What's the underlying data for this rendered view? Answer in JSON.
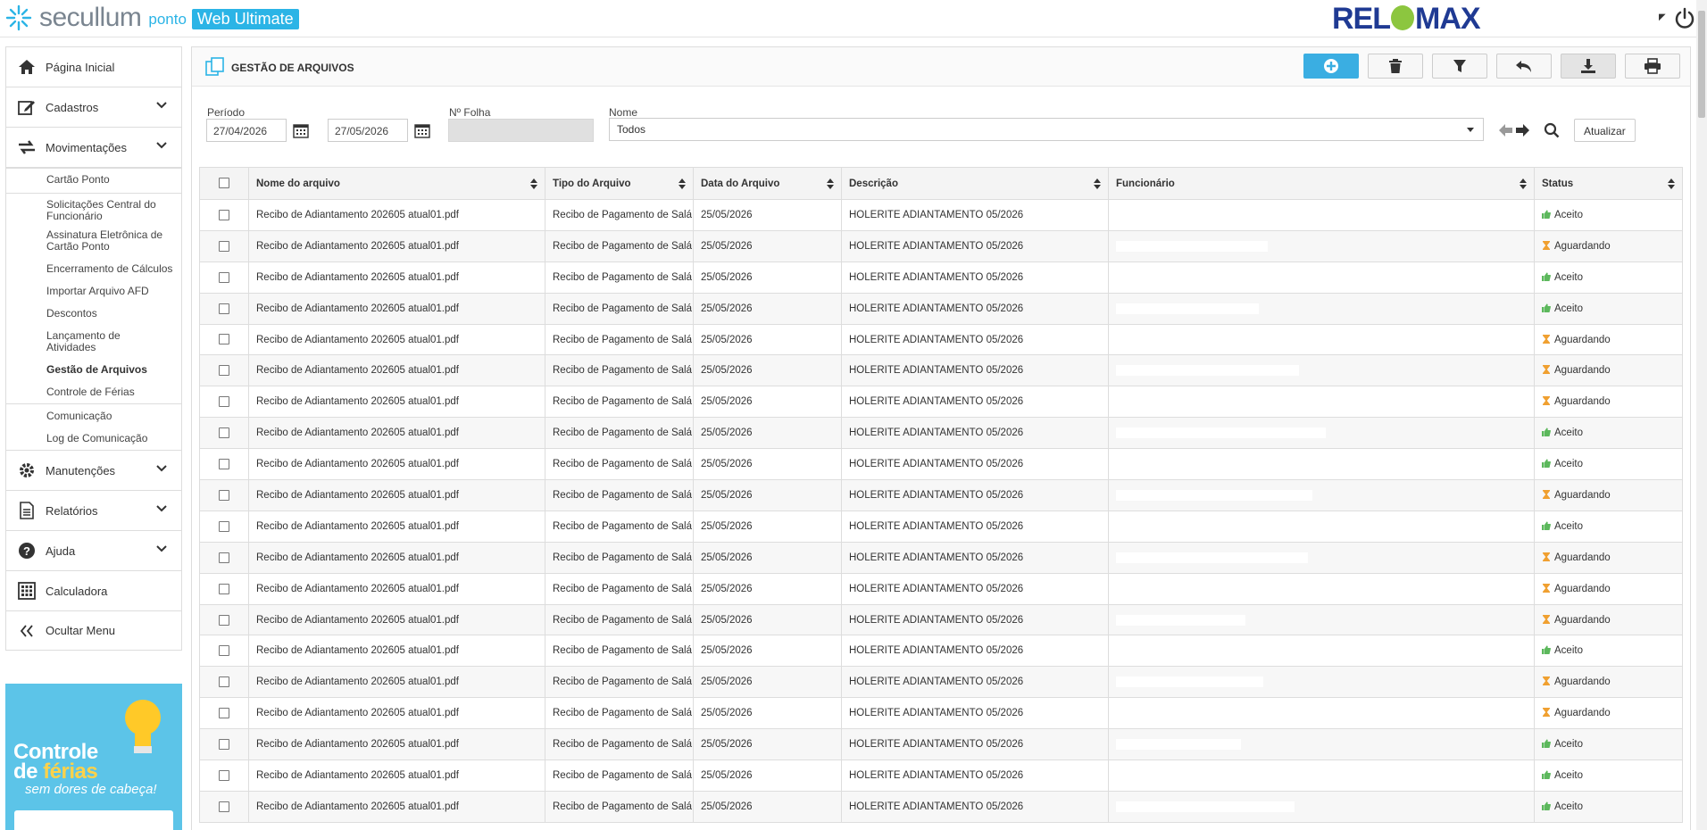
{
  "header": {
    "brand": "secullum",
    "brand_sub": "ponto",
    "brand_badge": "Web Ultimate",
    "client_logo_left": "REL",
    "client_logo_right": "MAX"
  },
  "sidebar": {
    "items": [
      {
        "label": "Página Inicial",
        "icon": "home-icon"
      },
      {
        "label": "Cadastros",
        "icon": "edit-icon"
      },
      {
        "label": "Movimentações",
        "icon": "exchange-icon"
      }
    ],
    "submenu": [
      "Cartão Ponto",
      "Solicitações Central do Funcionário",
      "Assinatura Eletrônica de Cartão Ponto",
      "Encerramento de Cálculos",
      "Importar Arquivo AFD",
      "Descontos",
      "Lançamento de Atividades",
      "Gestão de Arquivos",
      "Controle de Férias",
      "Comunicação",
      "Log de Comunicação"
    ],
    "items_after": [
      {
        "label": "Manutenções",
        "icon": "gear-icon"
      },
      {
        "label": "Relatórios",
        "icon": "document-icon"
      },
      {
        "label": "Ajuda",
        "icon": "help-icon"
      },
      {
        "label": "Calculadora",
        "icon": "calculator-icon"
      },
      {
        "label": "Ocultar Menu",
        "icon": "double-chevron-left-icon"
      }
    ],
    "banner": {
      "line1": "Controle",
      "line2a": "de ",
      "line2b": "férias",
      "line3": "sem dores de cabeça!"
    }
  },
  "panel": {
    "title": "GESTÃO DE ARQUIVOS"
  },
  "filters": {
    "periodo_label": "Período",
    "date_from": "27/04/2026",
    "date_to": "27/05/2026",
    "folha_label": "Nº Folha",
    "folha_value": "",
    "nome_label": "Nome",
    "nome_value": "Todos",
    "atualizar_label": "Atualizar"
  },
  "table": {
    "columns": [
      "Nome do arquivo",
      "Tipo do Arquivo",
      "Data do Arquivo",
      "Descrição",
      "Funcionário",
      "Status"
    ],
    "rows": [
      {
        "file": "Recibo de Adiantamento 202605 atual01.pdf",
        "type": "Recibo de Pagamento de Salá",
        "date": "25/05/2026",
        "desc": "HOLERITE ADIANTAMENTO 05/2026",
        "status": "Aceito"
      },
      {
        "file": "Recibo de Adiantamento 202605 atual01.pdf",
        "type": "Recibo de Pagamento de Salá",
        "date": "25/05/2026",
        "desc": "HOLERITE ADIANTAMENTO 05/2026",
        "status": "Aguardando"
      },
      {
        "file": "Recibo de Adiantamento 202605 atual01.pdf",
        "type": "Recibo de Pagamento de Salá",
        "date": "25/05/2026",
        "desc": "HOLERITE ADIANTAMENTO 05/2026",
        "status": "Aceito"
      },
      {
        "file": "Recibo de Adiantamento 202605 atual01.pdf",
        "type": "Recibo de Pagamento de Salá",
        "date": "25/05/2026",
        "desc": "HOLERITE ADIANTAMENTO 05/2026",
        "status": "Aceito"
      },
      {
        "file": "Recibo de Adiantamento 202605 atual01.pdf",
        "type": "Recibo de Pagamento de Salá",
        "date": "25/05/2026",
        "desc": "HOLERITE ADIANTAMENTO 05/2026",
        "status": "Aguardando"
      },
      {
        "file": "Recibo de Adiantamento 202605 atual01.pdf",
        "type": "Recibo de Pagamento de Salá",
        "date": "25/05/2026",
        "desc": "HOLERITE ADIANTAMENTO 05/2026",
        "status": "Aguardando"
      },
      {
        "file": "Recibo de Adiantamento 202605 atual01.pdf",
        "type": "Recibo de Pagamento de Salá",
        "date": "25/05/2026",
        "desc": "HOLERITE ADIANTAMENTO 05/2026",
        "status": "Aguardando"
      },
      {
        "file": "Recibo de Adiantamento 202605 atual01.pdf",
        "type": "Recibo de Pagamento de Salá",
        "date": "25/05/2026",
        "desc": "HOLERITE ADIANTAMENTO 05/2026",
        "status": "Aceito"
      },
      {
        "file": "Recibo de Adiantamento 202605 atual01.pdf",
        "type": "Recibo de Pagamento de Salá",
        "date": "25/05/2026",
        "desc": "HOLERITE ADIANTAMENTO 05/2026",
        "status": "Aceito"
      },
      {
        "file": "Recibo de Adiantamento 202605 atual01.pdf",
        "type": "Recibo de Pagamento de Salá",
        "date": "25/05/2026",
        "desc": "HOLERITE ADIANTAMENTO 05/2026",
        "status": "Aguardando"
      },
      {
        "file": "Recibo de Adiantamento 202605 atual01.pdf",
        "type": "Recibo de Pagamento de Salá",
        "date": "25/05/2026",
        "desc": "HOLERITE ADIANTAMENTO 05/2026",
        "status": "Aceito"
      },
      {
        "file": "Recibo de Adiantamento 202605 atual01.pdf",
        "type": "Recibo de Pagamento de Salá",
        "date": "25/05/2026",
        "desc": "HOLERITE ADIANTAMENTO 05/2026",
        "status": "Aguardando"
      },
      {
        "file": "Recibo de Adiantamento 202605 atual01.pdf",
        "type": "Recibo de Pagamento de Salá",
        "date": "25/05/2026",
        "desc": "HOLERITE ADIANTAMENTO 05/2026",
        "status": "Aguardando"
      },
      {
        "file": "Recibo de Adiantamento 202605 atual01.pdf",
        "type": "Recibo de Pagamento de Salá",
        "date": "25/05/2026",
        "desc": "HOLERITE ADIANTAMENTO 05/2026",
        "status": "Aguardando"
      },
      {
        "file": "Recibo de Adiantamento 202605 atual01.pdf",
        "type": "Recibo de Pagamento de Salá",
        "date": "25/05/2026",
        "desc": "HOLERITE ADIANTAMENTO 05/2026",
        "status": "Aceito"
      },
      {
        "file": "Recibo de Adiantamento 202605 atual01.pdf",
        "type": "Recibo de Pagamento de Salá",
        "date": "25/05/2026",
        "desc": "HOLERITE ADIANTAMENTO 05/2026",
        "status": "Aguardando"
      },
      {
        "file": "Recibo de Adiantamento 202605 atual01.pdf",
        "type": "Recibo de Pagamento de Salá",
        "date": "25/05/2026",
        "desc": "HOLERITE ADIANTAMENTO 05/2026",
        "status": "Aguardando"
      },
      {
        "file": "Recibo de Adiantamento 202605 atual01.pdf",
        "type": "Recibo de Pagamento de Salá",
        "date": "25/05/2026",
        "desc": "HOLERITE ADIANTAMENTO 05/2026",
        "status": "Aceito"
      },
      {
        "file": "Recibo de Adiantamento 202605 atual01.pdf",
        "type": "Recibo de Pagamento de Salá",
        "date": "25/05/2026",
        "desc": "HOLERITE ADIANTAMENTO 05/2026",
        "status": "Aceito"
      },
      {
        "file": "Recibo de Adiantamento 202605 atual01.pdf",
        "type": "Recibo de Pagamento de Salá",
        "date": "25/05/2026",
        "desc": "HOLERITE ADIANTAMENTO 05/2026",
        "status": "Aceito"
      }
    ]
  },
  "colors": {
    "accent": "#2bb4e6",
    "accepted": "#5cb85c",
    "waiting": "#f0a030",
    "relomax_blue": "#1f3a93"
  }
}
